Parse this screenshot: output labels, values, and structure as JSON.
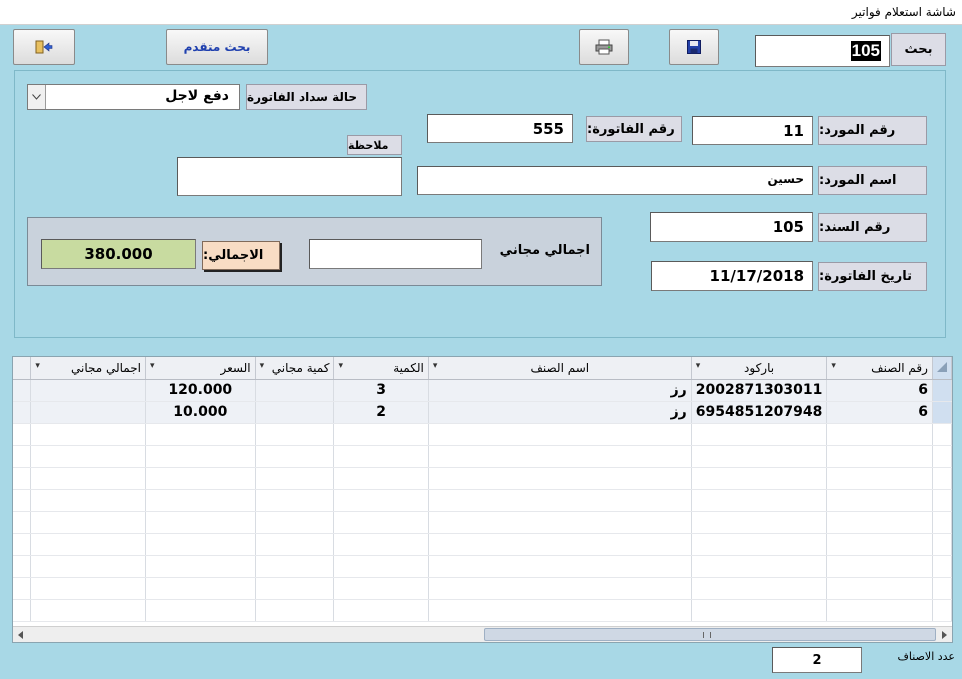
{
  "window": {
    "title": "شاشة استعلام فواتير"
  },
  "toolbar": {
    "advanced_search_label": "بحث متقدم",
    "search_label": "بحث",
    "search_value": "105",
    "search_caret": "ُ"
  },
  "form": {
    "payment_status_label": "حالة سداد الفاتورة",
    "payment_status_value": "دفع لاجل",
    "note_label": "ملاحظة",
    "note_value": "",
    "supplier_no_label": "رقم المورد:",
    "supplier_no_value": "11",
    "invoice_no_label": "رقم الفاتورة:",
    "invoice_no_value": "555",
    "supplier_name_label": "اسم المورد:",
    "supplier_name_value": "حسين",
    "voucher_no_label": "رقم السند:",
    "voucher_no_value": "105",
    "invoice_date_label": "تاريخ الفاتورة:",
    "invoice_date_value": "11/17/2018"
  },
  "totals": {
    "free_total_label": "اجمالي مجاني",
    "free_total_value": "",
    "total_label": "الاجمالي:",
    "total_value": "380.000"
  },
  "grid": {
    "columns": [
      "رقم الصنف",
      "باركود",
      "اسم الصنف",
      "الكمية",
      "كمية مجاني",
      "السعر",
      "اجمالي مجاني"
    ],
    "rows": [
      {
        "item_no": "6",
        "barcode": "2002871303011",
        "name": "رز",
        "qty": "3",
        "free_qty": "",
        "price": "120.000",
        "free_total": ""
      },
      {
        "item_no": "6",
        "barcode": "6954851207948",
        "name": "رز",
        "qty": "2",
        "free_qty": "",
        "price": "10.000",
        "free_total": ""
      }
    ]
  },
  "footer": {
    "items_count_label": "عدد الاصناف",
    "items_count_value": "2"
  },
  "colors": {
    "background": "#a8d8e6",
    "total_value_bg": "#c8dba0",
    "total_label_bg": "#f8dcc4",
    "advanced_search_text": "#1e3fae"
  },
  "icons": [
    "exit-icon",
    "printer-icon",
    "save-icon",
    "dropdown-arrow-icon",
    "sort-arrow-icon"
  ]
}
